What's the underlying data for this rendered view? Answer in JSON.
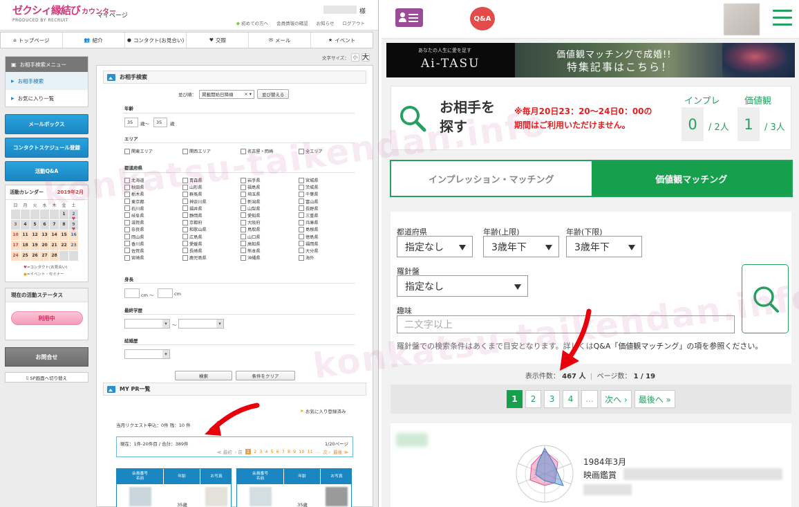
{
  "left": {
    "logo": {
      "main": "ゼクシィ縁結び",
      "counter": "カウンター",
      "sub": "PRODUCED BY RECRUIT"
    },
    "mypage": "マイページ",
    "sama": "様",
    "top_links": [
      "初めての方へ",
      "会員情報の確認",
      "お知らせ",
      "ログアウト"
    ],
    "nav": [
      "トップページ",
      "紹介",
      "コンタクト(お見合い)",
      "交際",
      "メール",
      "イベント"
    ],
    "font_size": {
      "label": "文字サイズ：",
      "small": "小",
      "big": "大"
    },
    "side": {
      "menu_title": "お相手検索メニュー",
      "menu_items": [
        "お相手検索",
        "お気に入り一覧"
      ],
      "buttons": [
        "メールボックス",
        "コンタクトスケジュール登録",
        "活動Q&A"
      ],
      "calendar": {
        "title": "活動カレンダー",
        "month": "2019年2月",
        "weekdays": [
          "日",
          "月",
          "火",
          "水",
          "木",
          "金",
          "土"
        ],
        "legend_contact": "=コンタクト(お見合い)",
        "legend_event": "=イベント・セミナー"
      },
      "status_title": "現在の活動ステータス",
      "status_value": "利用中",
      "inquiry": "お問合せ",
      "sp_switch": "SP画面へ切り替え"
    },
    "search": {
      "title": "お相手検索",
      "sort_label": "並び順：",
      "sort_value": "掲載開始日降順",
      "sort_button": "並び替える",
      "age_label": "年齢",
      "age_from": "35",
      "age_to": "35",
      "age_sep": "歳〜",
      "age_unit": "歳",
      "area_label": "エリア",
      "areas": [
        "関東エリア",
        "関西エリア",
        "名古屋・岡崎",
        "全エリア"
      ],
      "pref_label": "都道府県",
      "prefectures": [
        "北海道",
        "青森県",
        "岩手県",
        "宮城県",
        "秋田県",
        "山形県",
        "福島県",
        "茨城県",
        "栃木県",
        "群馬県",
        "埼玉県",
        "千葉県",
        "東京都",
        "神奈川県",
        "新潟県",
        "富山県",
        "石川県",
        "福井県",
        "山梨県",
        "長野県",
        "岐阜県",
        "静岡県",
        "愛知県",
        "三重県",
        "滋賀県",
        "京都府",
        "大阪府",
        "兵庫県",
        "奈良県",
        "和歌山県",
        "鳥取県",
        "島根県",
        "岡山県",
        "広島県",
        "山口県",
        "徳島県",
        "香川県",
        "愛媛県",
        "高知県",
        "福岡県",
        "佐賀県",
        "長崎県",
        "熊本県",
        "大分県",
        "宮崎県",
        "鹿児島県",
        "沖縄県",
        "海外"
      ],
      "height_label": "身長",
      "height_unit": "cm",
      "height_sep": "cm 〜",
      "edu_label": "最終学歴",
      "edu_sep": "〜",
      "marriage_label": "結婚歴",
      "search_button": "検索",
      "clear_button": "条件をクリア"
    },
    "pr": {
      "title": "MY PR一覧",
      "fav_legend": "お気に入り登録済み",
      "request_text": "当月リクエスト申込：0件 残：10 件",
      "current": "現在：1件-20件目 / 合計：389件",
      "page_total": "1/20ページ",
      "pager": [
        "≪ 最初",
        "‹ 前",
        "1",
        "2",
        "3",
        "4",
        "5",
        "6",
        "7",
        "8",
        "9",
        "10",
        "11",
        "...",
        "次 ›",
        "最後 ≫"
      ],
      "table_headers": [
        "会員番号\n名前",
        "年齢",
        "お写真"
      ],
      "ages": [
        "35歳",
        "35歳"
      ]
    }
  },
  "right": {
    "qa_label": "Q&A",
    "banner": {
      "tagline": "あなたの人生に愛を足す",
      "brand": "Ai-TASU",
      "line1": "価値観マッチングで成婚!!",
      "line2": "特集記事はこちら！"
    },
    "search_title": "お相手を\n探す",
    "warning": "※毎月20日23：20〜24日0：00の\n期間はご利用いただけません。",
    "impression": {
      "label": "インプレ",
      "value": "0",
      "total": "/ 2人"
    },
    "values": {
      "label": "価値観",
      "value": "1",
      "total": "/ 3人"
    },
    "tabs": [
      "インプレッション・マッチング",
      "価値観マッチング"
    ],
    "filters": {
      "pref_label": "都道府県",
      "pref_value": "指定なし",
      "age_upper_label": "年齢(上限)",
      "age_upper_value": "3歳年下",
      "age_lower_label": "年齢(下限)",
      "age_lower_value": "3歳年下",
      "compass_label": "羅針盤",
      "compass_value": "指定なし",
      "hobby_label": "趣味",
      "hobby_placeholder": "二文字以上"
    },
    "note_prefix": "羅針盤での検索条件はあくまで目安となります。詳しくは",
    "note_link": "Q&A「価値観マッチング」の項を参照ください。",
    "count": {
      "label": "表示件数：",
      "value": "467 人",
      "page_label": "ページ数：",
      "page_value": "1 / 19"
    },
    "pager": [
      "1",
      "2",
      "3",
      "4",
      "…",
      "次へ ›",
      "最後へ »"
    ],
    "member": {
      "birth": "1984年3月",
      "hobby": "映画鑑賞"
    }
  },
  "watermark": "konkatsu-taikendan.info",
  "colors": {
    "green": "#16a04d",
    "pink": "#d23a7c",
    "blue": "#1a86c2",
    "red_arrow": "#e8000a"
  }
}
